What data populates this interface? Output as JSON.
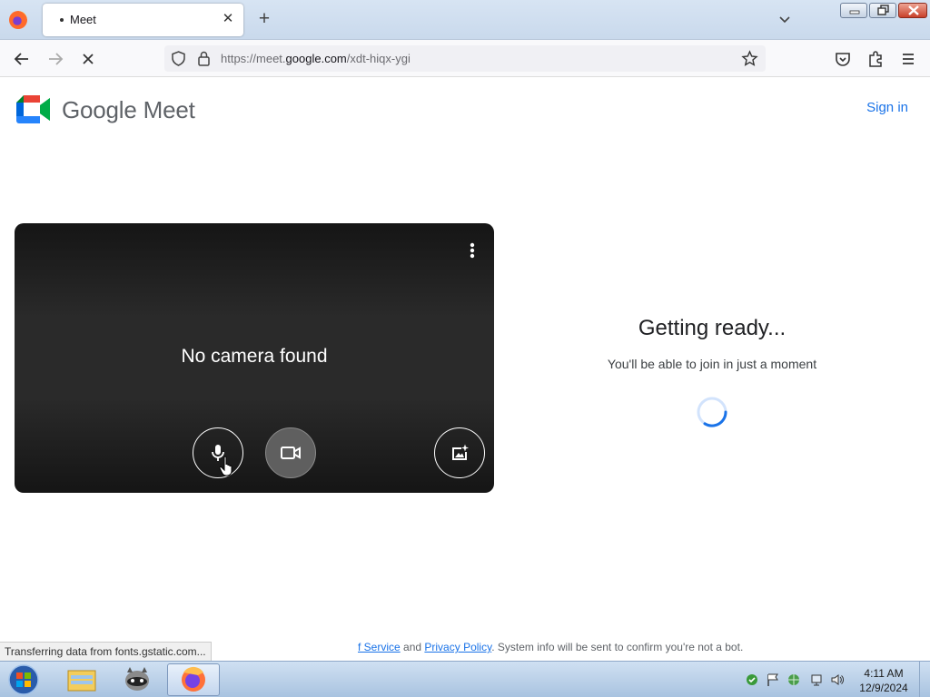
{
  "browser": {
    "tab_title": "Meet",
    "new_tab_symbol": "+",
    "close_symbol": "✕",
    "url_prefix": "https://meet.",
    "url_host": "google.com",
    "url_path": "/xdt-hiqx-ygi",
    "icons": [
      "firefox-icon",
      "tab-close-icon",
      "new-tab-icon",
      "tab-list-icon",
      "minimize-icon",
      "restore-icon",
      "close-window-icon",
      "back-icon",
      "forward-icon",
      "stop-loading-icon",
      "shield-icon",
      "lock-icon",
      "bookmark-star-icon",
      "pocket-icon",
      "extensions-icon",
      "menu-icon"
    ]
  },
  "page": {
    "logo_text": "Google Meet",
    "sign_in": "Sign in",
    "preview": {
      "no_camera": "No camera found"
    },
    "ready_title": "Getting ready...",
    "ready_subtitle": "You'll be able to join in just a moment",
    "footer": {
      "link1": "f Service",
      "and": " and ",
      "link2": "Privacy Policy",
      "rest": ". System info will be sent to confirm you're not a bot."
    },
    "status_bar": "Transferring data from fonts.gstatic.com..."
  },
  "taskbar": {
    "time": "4:11 AM",
    "date": "12/9/2024"
  },
  "colors": {
    "accent": "#1a73e8",
    "preview_bg": "#202124",
    "camera_off_button": "#5f5f5f"
  }
}
